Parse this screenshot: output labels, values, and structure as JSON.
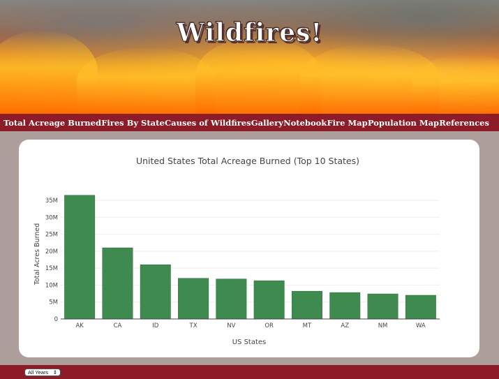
{
  "header": {
    "title": "Wildfires!"
  },
  "nav": {
    "items": [
      "Total Acreage Burned",
      "Fires By State",
      "Causes of Wildfires",
      "Gallery",
      "Notebook",
      "Fire Map",
      "Population Map",
      "References"
    ]
  },
  "controls": {
    "year_select": "All Years"
  },
  "colors": {
    "bar": "#3e8a4f",
    "nav": "#8c1d28",
    "background": "#ae9f9c"
  },
  "chart_data": {
    "type": "bar",
    "title": "United States Total Acreage Burned (Top 10 States)",
    "xlabel": "US States",
    "ylabel": "Total Acres Burned",
    "categories": [
      "AK",
      "CA",
      "ID",
      "TX",
      "NV",
      "OR",
      "MT",
      "AZ",
      "NM",
      "WA"
    ],
    "values": [
      36500000,
      21000000,
      16000000,
      12000000,
      11800000,
      11300000,
      8200000,
      7800000,
      7400000,
      7000000
    ],
    "ylim": [
      0,
      35000000
    ],
    "yticks": [
      0,
      5000000,
      10000000,
      15000000,
      20000000,
      25000000,
      30000000,
      35000000
    ],
    "ytick_labels": [
      "0",
      "5M",
      "10M",
      "15M",
      "20M",
      "25M",
      "30M",
      "35M"
    ],
    "grid": true
  }
}
